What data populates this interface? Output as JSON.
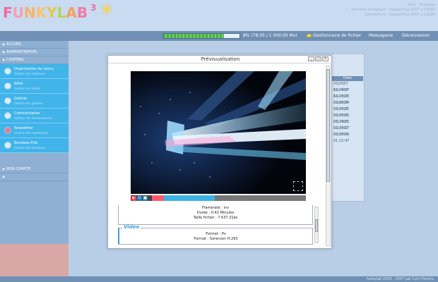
{
  "app": {
    "logo_letters": [
      "F",
      "U",
      "N",
      "K",
      "Y",
      "L",
      "A",
      "B"
    ],
    "logo_colors": [
      "#f26b9a",
      "#f59fb7",
      "#f8b26a",
      "#f9c56a",
      "#e6c84a",
      "#b4d45a",
      "#f3a15e",
      "#ef7aa8"
    ],
    "logo_version": "3",
    "header_info": [
      "Vous : Funkylab",
      "Derniere connexion : Aujourd'hui 2007 a 13h00",
      "Connecte le : Aujourd'hui 2007 a 13h00"
    ]
  },
  "topbar": {
    "progress_percent": 0.8,
    "progress_text": "8% (78,05 / 1 000,00 Mo)",
    "gestionnaire_label": "Gestionnaire de fichier",
    "messagerie_label": "Messagerie",
    "deconnexion_label": "Déconnexion"
  },
  "sidebar": {
    "sections": {
      "accueil": "ACCUEIL",
      "administration": "ADMINISTRATION",
      "contenu": "CONTENU",
      "mon_compte": "MON COMPTE"
    },
    "items": [
      {
        "title": "Organisation du menu",
        "desc": "Gestion des rubriques",
        "icon": "globe-icon"
      },
      {
        "title": "Billet",
        "desc": "Gestion des billets",
        "icon": "document-icon"
      },
      {
        "title": "Galerie",
        "desc": "Gestion des galeries",
        "icon": "image-icon"
      },
      {
        "title": "Commentaires",
        "desc": "Gestion des commentaires",
        "icon": "comment-icon"
      },
      {
        "title": "Newsletter",
        "desc": "Gestion des newsletters",
        "icon": "mail-icon"
      },
      {
        "title": "Bandeau Pub",
        "desc": "Gestion des bandeaux",
        "icon": "banner-icon"
      }
    ]
  },
  "panel": {
    "date_header": "Date",
    "dates": [
      "03/2007 11:24:57",
      "03/2007 11:25:25",
      "03/2007 01:05:34",
      "03/2007 01:13:21",
      "03/2007 01:15:52",
      "03/2007 01:24:21",
      "03/2007 01:16:17",
      "03/2007 01:15:59",
      "03/2007 01:15:47"
    ]
  },
  "modal": {
    "title": "Prévisualisation",
    "info_lines": [
      "Framerate : inv",
      "Durée : 0:42 Minutes",
      "Taille fichier : 7 637,31ko"
    ],
    "video_legend": "Video",
    "video_lines": [
      "Format : flv",
      "Format : Sorenson H.263"
    ],
    "seek": {
      "played_fraction": 0.08,
      "buffer_start_fraction": 0.08,
      "buffer_fraction": 0.33
    }
  },
  "footer": {
    "text": "funkylab 2003 - 2007 par Cyril Pereira"
  }
}
